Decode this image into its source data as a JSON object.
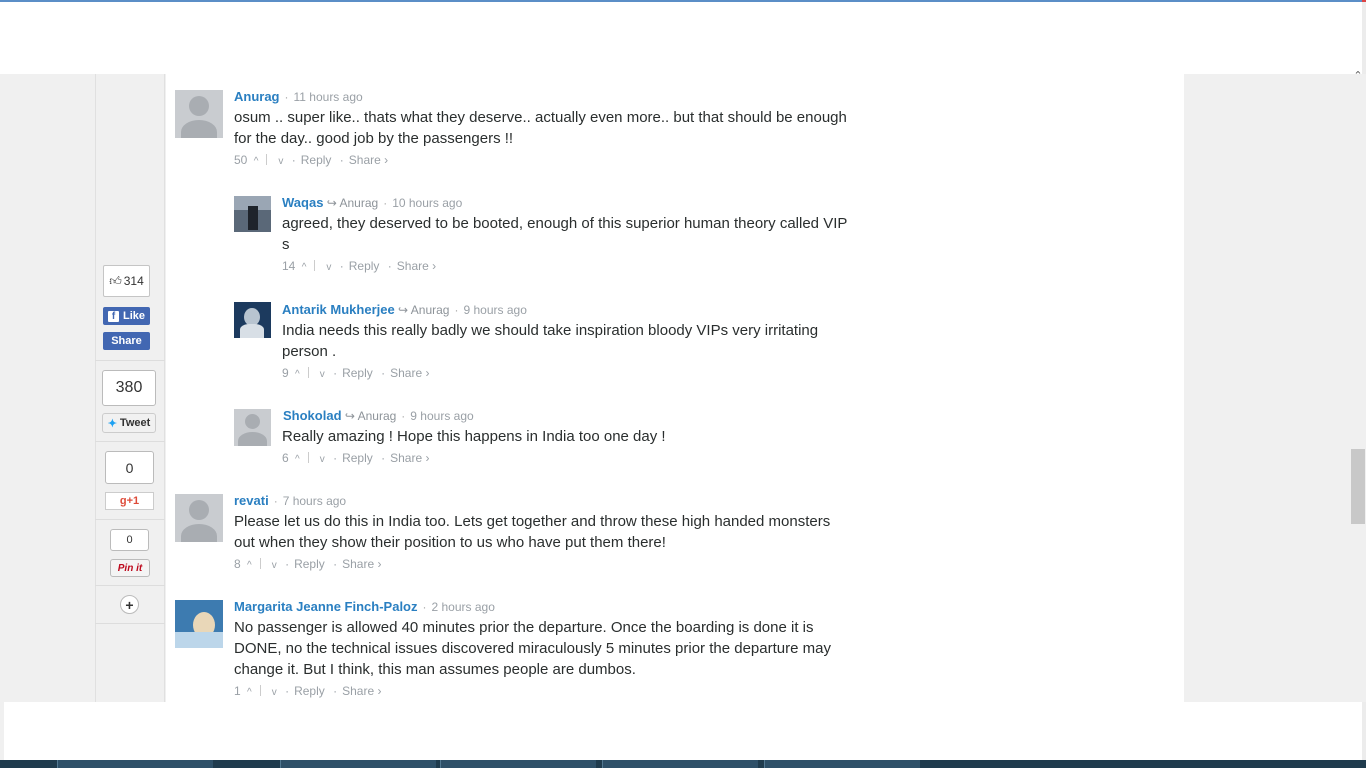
{
  "share": {
    "facebook_count": "314",
    "like_label": "Like",
    "share_label": "Share",
    "twitter_count": "380",
    "tweet_label": "Tweet",
    "gplus_count": "0",
    "gplus_label": "+1",
    "pinterest_count": "0",
    "pinterest_label": "Pin it",
    "more_label": "+"
  },
  "comments": [
    {
      "author": "Anurag",
      "reply_to": "",
      "time": "11 hours ago",
      "text": "osum .. super like.. thats what they deserve.. actually even more.. but that should be enough for the day.. good job by the passengers !!",
      "votes": "50"
    },
    {
      "author": "Waqas",
      "reply_to": "Anurag",
      "time": "10 hours ago",
      "text": "agreed, they deserved to be booted, enough of this superior human theory called VIP s",
      "votes": "14"
    },
    {
      "author": "Antarik Mukherjee",
      "reply_to": "Anurag",
      "time": "9 hours ago",
      "text": "India needs this really badly we should take inspiration bloody VIPs very irritating person .",
      "votes": "9"
    },
    {
      "author": "Shokolad",
      "reply_to": "Anurag",
      "time": "9 hours ago",
      "text": "Really amazing ! Hope this happens in India too one day !",
      "votes": "6"
    },
    {
      "author": "revati",
      "reply_to": "",
      "time": "7 hours ago",
      "text": "Please let us do this in India too. Lets get together and throw these high handed monsters out when they show their position to us who have put them there!",
      "votes": "8"
    },
    {
      "author": "Margarita Jeanne Finch-Paloz",
      "reply_to": "",
      "time": "2 hours ago",
      "text": "No passenger is allowed 40 minutes prior the departure. Once the boarding is done it is DONE, no the technical issues discovered miraculously 5 minutes prior the departure may change it. But I think, this man assumes people are dumbos.",
      "votes": "1"
    }
  ],
  "labels": {
    "reply": "Reply",
    "share": "Share",
    "share_arrow": "›",
    "upvote_icon": "^",
    "downvote_icon": "v",
    "reply_to_icon": "↪"
  }
}
